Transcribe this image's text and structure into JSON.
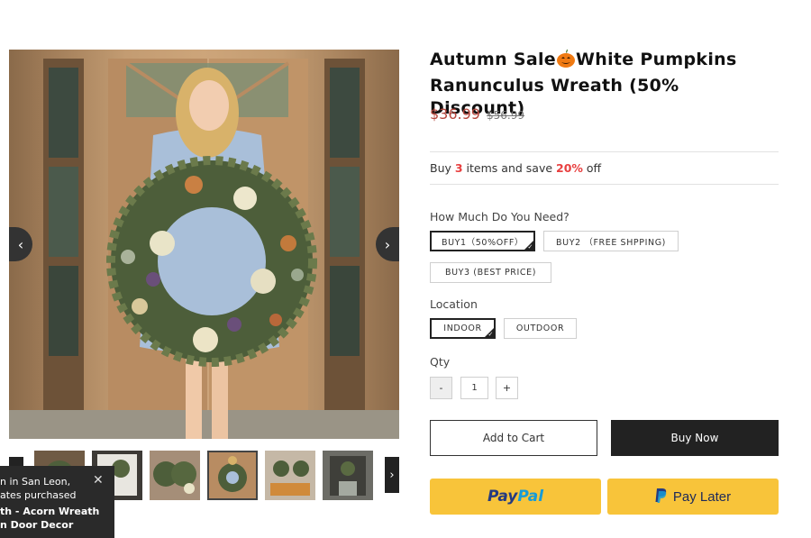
{
  "product": {
    "title_part1": "Autumn Sale",
    "title_part2": "White Pumpkins Ranunculus Wreath (50% Discount)",
    "price": "$36.99",
    "compare_price": "$56.99"
  },
  "bundle": {
    "prefix": "Buy ",
    "qty": "3",
    "middle": " items and save ",
    "percent": "20%",
    "suffix": " off"
  },
  "options": {
    "need": {
      "label": "How Much Do You Need?",
      "values": [
        "BUY1（50%OFF）",
        "BUY2 （FREE SHPPING)",
        "BUY3 (BEST PRICE)"
      ],
      "selected": "BUY1（50%OFF）"
    },
    "location": {
      "label": "Location",
      "values": [
        "INDOOR",
        "OUTDOOR"
      ],
      "selected": "INDOOR"
    }
  },
  "quantity": {
    "label": "Qty",
    "minus": "-",
    "value": "1",
    "plus": "+"
  },
  "actions": {
    "add_to_cart": "Add to Cart",
    "buy_now": "Buy Now",
    "paypal_pay": "Pay",
    "paypal_pal": "Pal",
    "paypal_later": "Pay Later"
  },
  "gallery": {
    "prev_icon": "‹",
    "next_icon": "›",
    "thumb_next_icon": "›",
    "thumb_count": 6,
    "active_thumb": 3
  },
  "toast": {
    "line1": "n in San Leon,",
    "line2": "ates purchased",
    "line3": "th - Acorn Wreath",
    "line4": "n Door Decor",
    "close": "✕"
  },
  "colors": {
    "price": "#b5463c",
    "highlight": "#e84040",
    "dark_button": "#222222",
    "paypal_yellow": "#f8c43a",
    "paypal_dark_blue": "#253b80",
    "paypal_light_blue": "#179bd7"
  }
}
